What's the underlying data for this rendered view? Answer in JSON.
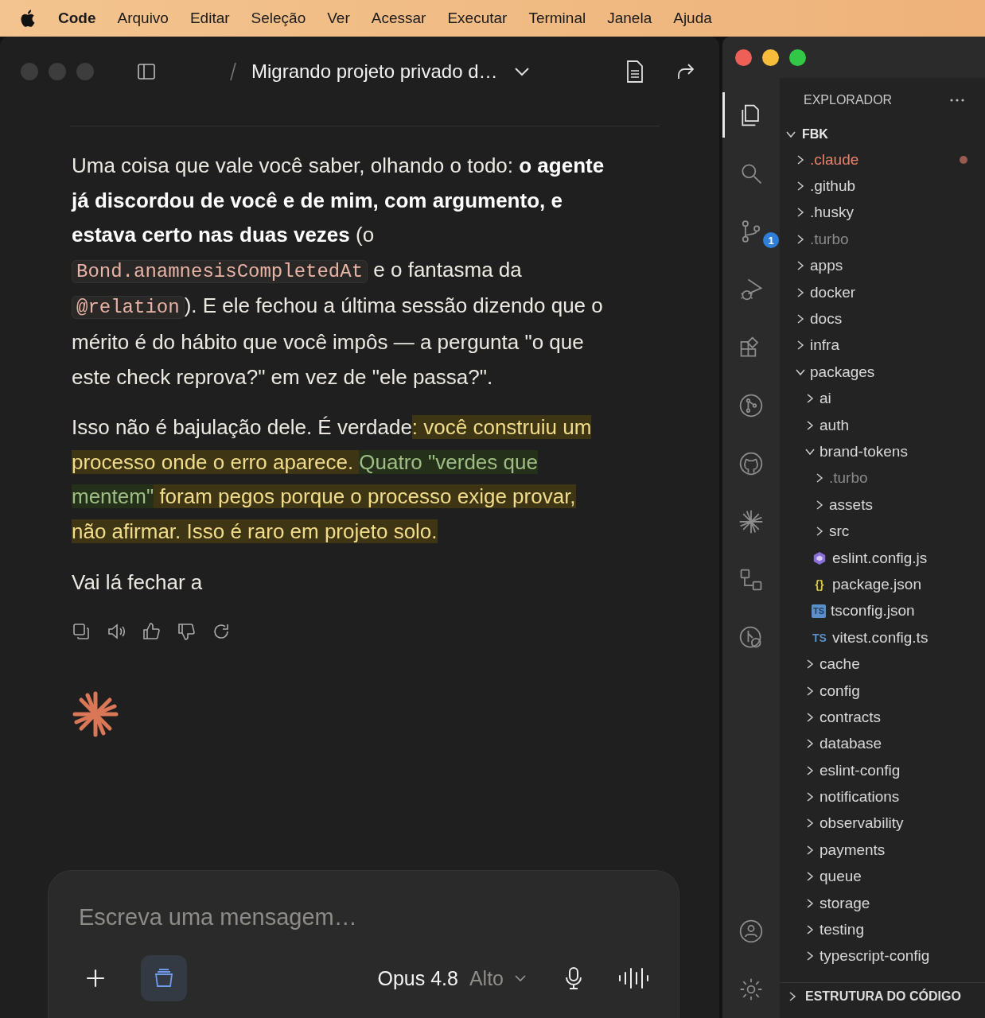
{
  "menu_bar": {
    "app": "Code",
    "items": [
      "Arquivo",
      "Editar",
      "Seleção",
      "Ver",
      "Acessar",
      "Executar",
      "Terminal",
      "Janela",
      "Ajuda"
    ]
  },
  "chat": {
    "title": "Migrando projeto privado d…",
    "paragraphs": [
      {
        "segments": [
          {
            "kind": "text",
            "text": "Uma coisa que vale você saber, olhando o todo: "
          },
          {
            "kind": "bold",
            "text": "o agente já discordou de você e de mim, com argumento, e estava certo nas duas vezes"
          },
          {
            "kind": "text",
            "text": " (o "
          },
          {
            "kind": "code",
            "text": "Bond.anamnesisCompletedAt"
          },
          {
            "kind": "text",
            "text": " e o fantasma da "
          },
          {
            "kind": "code",
            "text": "@relation"
          },
          {
            "kind": "text",
            "text": "). E ele fechou a última sessão dizendo que o mérito é do hábito que você impôs — a pergunta \"o que este check reprova?\" em vez de \"ele passa?\"."
          }
        ]
      },
      {
        "segments": [
          {
            "kind": "text",
            "text": "Isso não é bajulação dele. É verdade"
          },
          {
            "kind": "highlight",
            "text": ": você construiu um processo onde o erro aparece. "
          },
          {
            "kind": "green",
            "text": "Quatro \"verdes que mentem\""
          },
          {
            "kind": "highlight",
            "text": " foram pegos porque o processo exige provar, não afirmar. Isso é raro em projeto solo."
          }
        ]
      },
      {
        "segments": [
          {
            "kind": "text",
            "text": "Vai lá fechar a"
          }
        ]
      }
    ],
    "composer": {
      "placeholder": "Escreva uma mensagem…",
      "model": "Opus 4.8",
      "effort": "Alto"
    }
  },
  "editor": {
    "activity": [
      {
        "kind": "files",
        "selected": true
      },
      {
        "kind": "search",
        "selected": false
      },
      {
        "kind": "source-control",
        "selected": false,
        "badge": "1"
      },
      {
        "kind": "debug",
        "selected": false
      },
      {
        "kind": "extensions",
        "selected": false
      },
      {
        "kind": "git-graph",
        "selected": false
      },
      {
        "kind": "github",
        "selected": false
      },
      {
        "kind": "sparkle",
        "selected": false
      },
      {
        "kind": "remote",
        "selected": false
      },
      {
        "kind": "history",
        "selected": false
      }
    ],
    "explorer_title": "EXPLORADOR",
    "root": {
      "name": "FBK",
      "expanded": true
    },
    "tree": [
      {
        "kind": "folder",
        "name": ".claude",
        "expanded": false,
        "modified": true,
        "ignored": false
      },
      {
        "kind": "folder",
        "name": ".github",
        "expanded": false,
        "modified": false,
        "ignored": false
      },
      {
        "kind": "folder",
        "name": ".husky",
        "expanded": false,
        "modified": false,
        "ignored": false
      },
      {
        "kind": "folder",
        "name": ".turbo",
        "expanded": false,
        "modified": false,
        "ignored": true
      },
      {
        "kind": "folder",
        "name": "apps",
        "expanded": false,
        "modified": false,
        "ignored": false
      },
      {
        "kind": "folder",
        "name": "docker",
        "expanded": false,
        "modified": false,
        "ignored": false
      },
      {
        "kind": "folder",
        "name": "docs",
        "expanded": false,
        "modified": false,
        "ignored": false
      },
      {
        "kind": "folder",
        "name": "infra",
        "expanded": false,
        "modified": false,
        "ignored": false
      },
      {
        "kind": "folder",
        "name": "packages",
        "expanded": true,
        "modified": false,
        "ignored": false,
        "children": [
          {
            "kind": "folder",
            "name": "ai",
            "expanded": false,
            "modified": false,
            "ignored": false
          },
          {
            "kind": "folder",
            "name": "auth",
            "expanded": false,
            "modified": false,
            "ignored": false
          },
          {
            "kind": "folder",
            "name": "brand-tokens",
            "expanded": true,
            "modified": false,
            "ignored": false,
            "children": [
              {
                "kind": "folder",
                "name": ".turbo",
                "expanded": false,
                "modified": false,
                "ignored": true
              },
              {
                "kind": "folder",
                "name": "assets",
                "expanded": false,
                "modified": false,
                "ignored": false
              },
              {
                "kind": "folder",
                "name": "src",
                "expanded": false,
                "modified": false,
                "ignored": false
              },
              {
                "kind": "eslint",
                "name": "eslint.config.js",
                "modified": false,
                "ignored": false
              },
              {
                "kind": "json",
                "name": "package.json",
                "icon_text": "{}",
                "modified": false,
                "ignored": false
              },
              {
                "kind": "tsconfig",
                "name": "tsconfig.json",
                "icon_text": "TS",
                "modified": false,
                "ignored": false
              },
              {
                "kind": "typescript",
                "name": "vitest.config.ts",
                "icon_text": "TS",
                "modified": false,
                "ignored": false
              }
            ]
          },
          {
            "kind": "folder",
            "name": "cache",
            "expanded": false,
            "modified": false,
            "ignored": false
          },
          {
            "kind": "folder",
            "name": "config",
            "expanded": false,
            "modified": false,
            "ignored": false
          },
          {
            "kind": "folder",
            "name": "contracts",
            "expanded": false,
            "modified": false,
            "ignored": false
          },
          {
            "kind": "folder",
            "name": "database",
            "expanded": false,
            "modified": false,
            "ignored": false
          },
          {
            "kind": "folder",
            "name": "eslint-config",
            "expanded": false,
            "modified": false,
            "ignored": false
          },
          {
            "kind": "folder",
            "name": "notifications",
            "expanded": false,
            "modified": false,
            "ignored": false
          },
          {
            "kind": "folder",
            "name": "observability",
            "expanded": false,
            "modified": false,
            "ignored": false
          },
          {
            "kind": "folder",
            "name": "payments",
            "expanded": false,
            "modified": false,
            "ignored": false
          },
          {
            "kind": "folder",
            "name": "queue",
            "expanded": false,
            "modified": false,
            "ignored": false
          },
          {
            "kind": "folder",
            "name": "storage",
            "expanded": false,
            "modified": false,
            "ignored": false
          },
          {
            "kind": "folder",
            "name": "testing",
            "expanded": false,
            "modified": false,
            "ignored": false
          },
          {
            "kind": "folder",
            "name": "typescript-config",
            "expanded": false,
            "modified": false,
            "ignored": false
          }
        ]
      }
    ],
    "outline_title": "ESTRUTURA DO CÓDIGO"
  }
}
